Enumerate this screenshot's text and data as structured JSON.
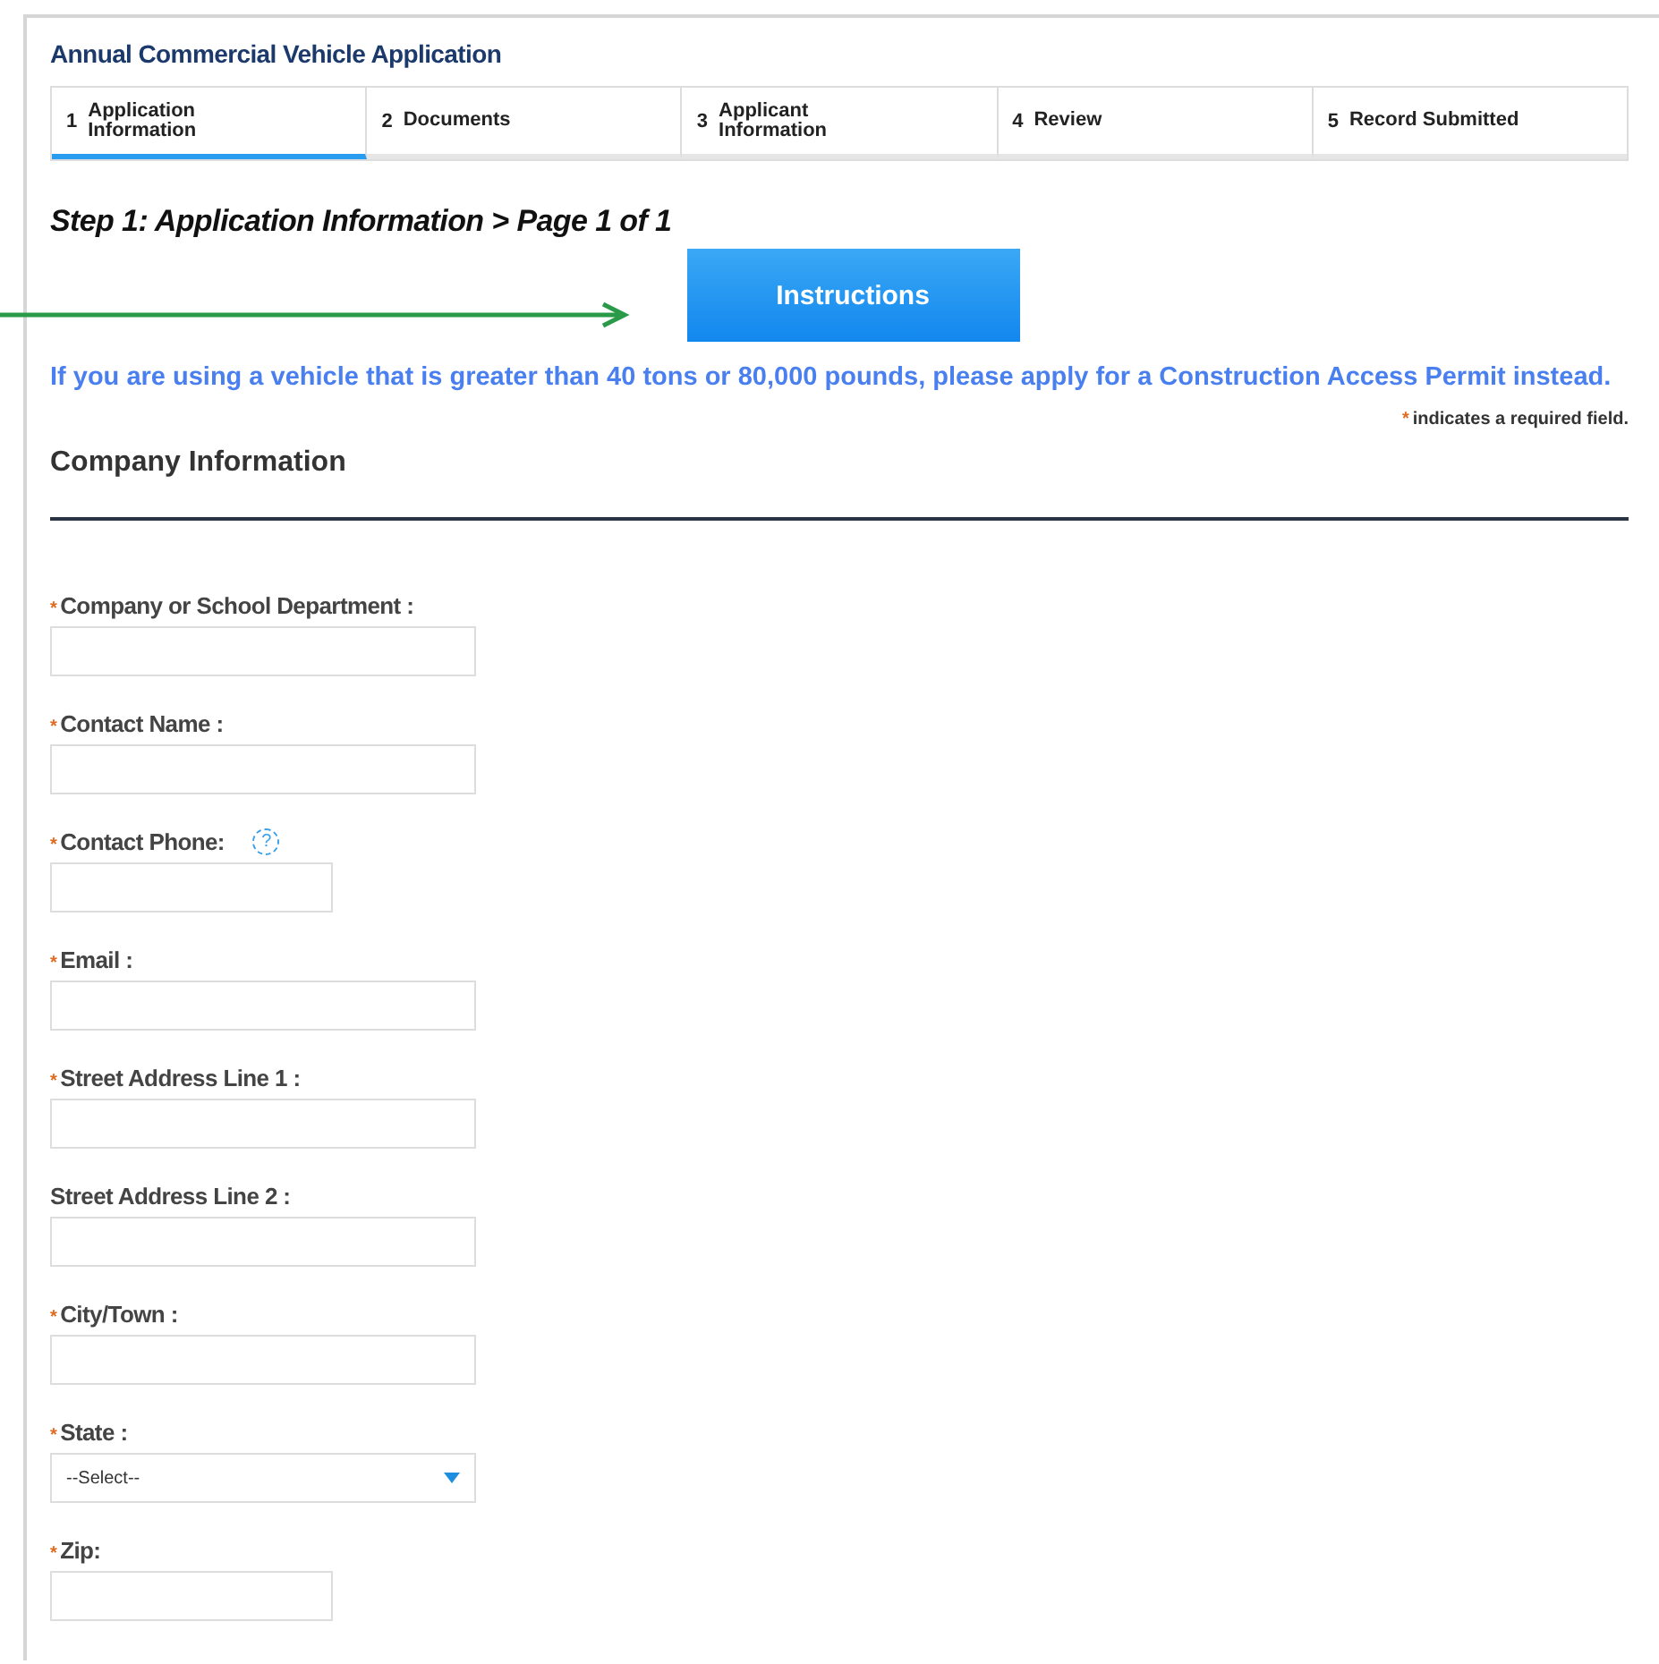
{
  "page_title": "Annual Commercial Vehicle Application",
  "steps": [
    {
      "number": "1",
      "label": "Application Information",
      "selected": true
    },
    {
      "number": "2",
      "label": "Documents",
      "selected": false
    },
    {
      "number": "3",
      "label": "Applicant Information",
      "selected": false
    },
    {
      "number": "4",
      "label": "Review",
      "selected": false
    },
    {
      "number": "5",
      "label": "Record Submitted",
      "selected": false
    }
  ],
  "step_heading": "Step 1: Application Information > Page 1 of 1",
  "instructions_button": "Instructions",
  "notice": "If you are using a vehicle that is greater than 40 tons or 80,000 pounds, please apply for a Construction Access Permit instead.",
  "required_note": {
    "mark": "*",
    "text": "indicates a required field."
  },
  "section_title": "Company Information",
  "fields": [
    {
      "label": "Company or School Department :",
      "required": true,
      "kind": "text"
    },
    {
      "label": "Contact Name :",
      "required": true,
      "kind": "text"
    },
    {
      "label": "Contact Phone:",
      "required": true,
      "kind": "short_text",
      "help": "?"
    },
    {
      "label": "Email :",
      "required": true,
      "kind": "text"
    },
    {
      "label": "Street Address Line 1 :",
      "required": true,
      "kind": "text"
    },
    {
      "label": "Street Address Line 2 :",
      "required": false,
      "kind": "text"
    },
    {
      "label": "City/Town :",
      "required": true,
      "kind": "text"
    },
    {
      "label": "State :",
      "required": true,
      "kind": "select",
      "value": "--Select--"
    },
    {
      "label": "Zip:",
      "required": true,
      "kind": "short_text"
    }
  ]
}
